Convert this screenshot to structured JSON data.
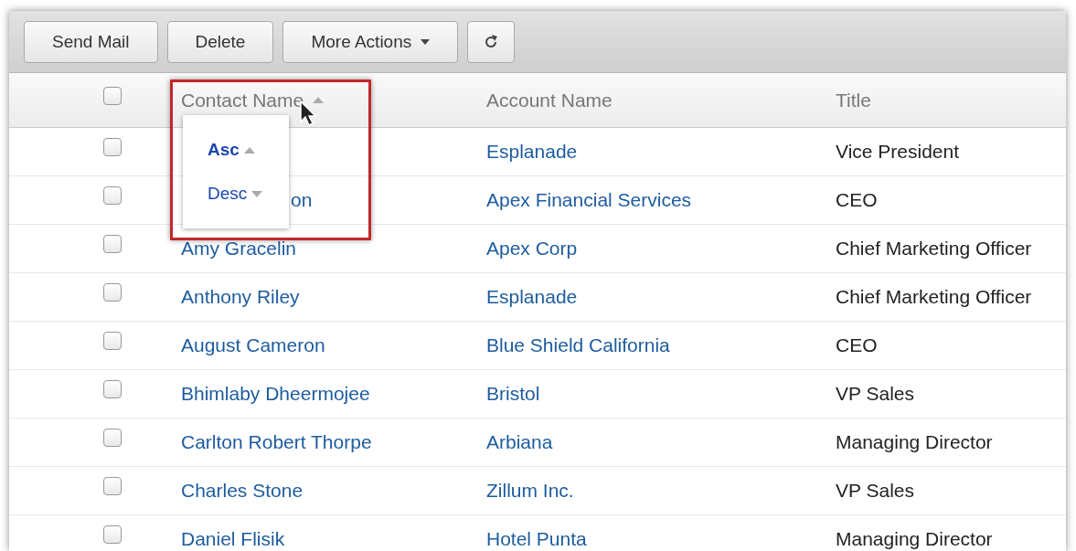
{
  "toolbar": {
    "buttons": [
      {
        "label": "Send Mail",
        "kind": "text"
      },
      {
        "label": "Delete",
        "kind": "text"
      },
      {
        "label": "More Actions",
        "kind": "dropdown"
      },
      {
        "kind": "refresh"
      }
    ]
  },
  "table": {
    "select_all": {
      "checked": false
    },
    "columns": [
      {
        "label": "Contact Name",
        "sorted": true
      },
      {
        "label": "Account Name",
        "sorted": false
      },
      {
        "label": "Title",
        "sorted": false
      }
    ],
    "rows": [
      {
        "checked": false,
        "account": "Esplanade",
        "title": "Vice President"
      },
      {
        "checked": false,
        "contact": "on",
        "contact_covered": true,
        "account": "Apex Financial Services",
        "title": "CEO"
      },
      {
        "checked": false,
        "contact": "Amy Gracelin",
        "account": "Apex Corp",
        "title": "Chief Marketing Officer"
      },
      {
        "checked": false,
        "contact": "Anthony Riley",
        "account": "Esplanade",
        "title": "Chief Marketing Officer"
      },
      {
        "checked": false,
        "contact": "August Cameron",
        "account": "Blue Shield California",
        "title": "CEO"
      },
      {
        "checked": false,
        "contact": "Bhimlaby Dheermojee",
        "account": "Bristol",
        "title": "VP Sales"
      },
      {
        "checked": false,
        "contact": "Carlton Robert Thorpe",
        "account": "Arbiana",
        "title": "Managing Director"
      },
      {
        "checked": false,
        "contact": "Charles Stone",
        "account": "Zillum Inc.",
        "title": "VP Sales"
      },
      {
        "checked": false,
        "contact": "Daniel Flisik",
        "account": "Hotel Punta",
        "title": "Managing Director"
      }
    ]
  },
  "sort_menu": {
    "items": [
      {
        "label": "Asc",
        "kind": "up",
        "selected": true
      },
      {
        "label": "Desc",
        "kind": "down",
        "selected": false
      }
    ]
  }
}
